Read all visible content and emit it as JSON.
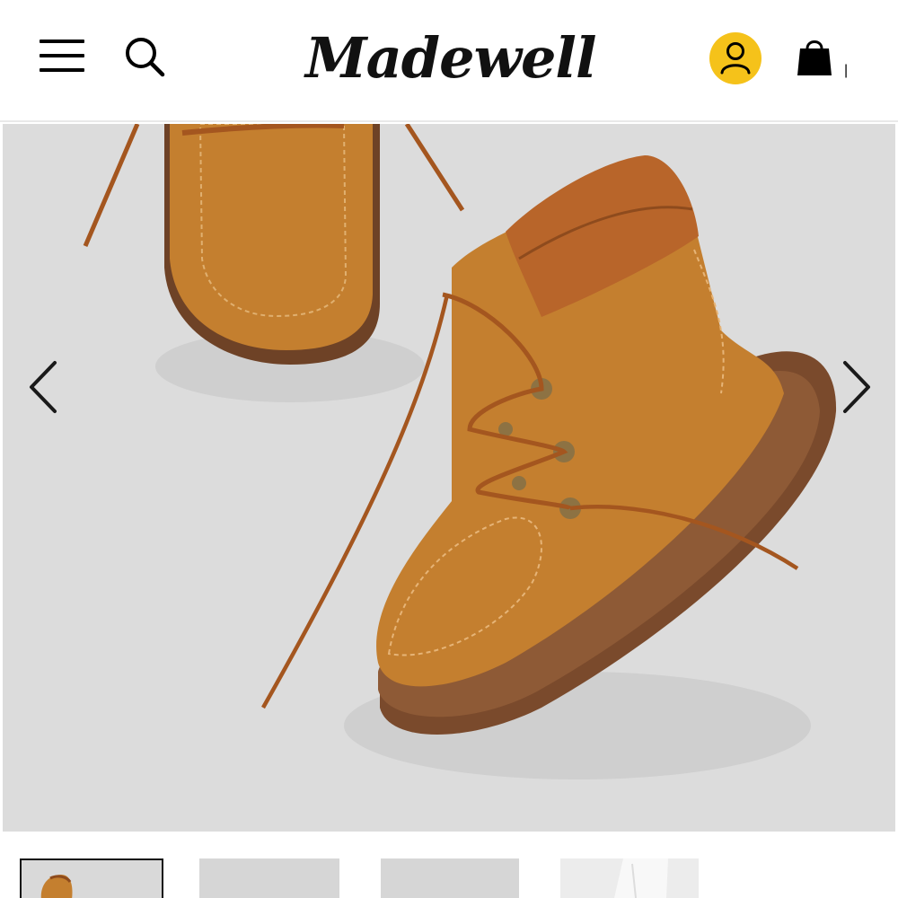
{
  "header": {
    "logo_text": "Madewell",
    "menu_icon": "hamburger-menu-icon",
    "search_icon": "search-icon",
    "account_icon": "account-icon",
    "bag_icon": "shopping-bag-icon",
    "bag_count": "|",
    "account_color": "#f5c21a"
  },
  "gallery": {
    "prev_icon": "chevron-left-icon",
    "next_icon": "chevron-right-icon",
    "background_color": "#dcdcdc",
    "thumbnails": [
      {
        "selected": true
      },
      {
        "selected": false
      },
      {
        "selected": false
      },
      {
        "selected": false
      }
    ]
  },
  "colors": {
    "boot_suede": "#c47f2f",
    "boot_leather": "#b8652a",
    "sole": "#7a4a2c"
  }
}
